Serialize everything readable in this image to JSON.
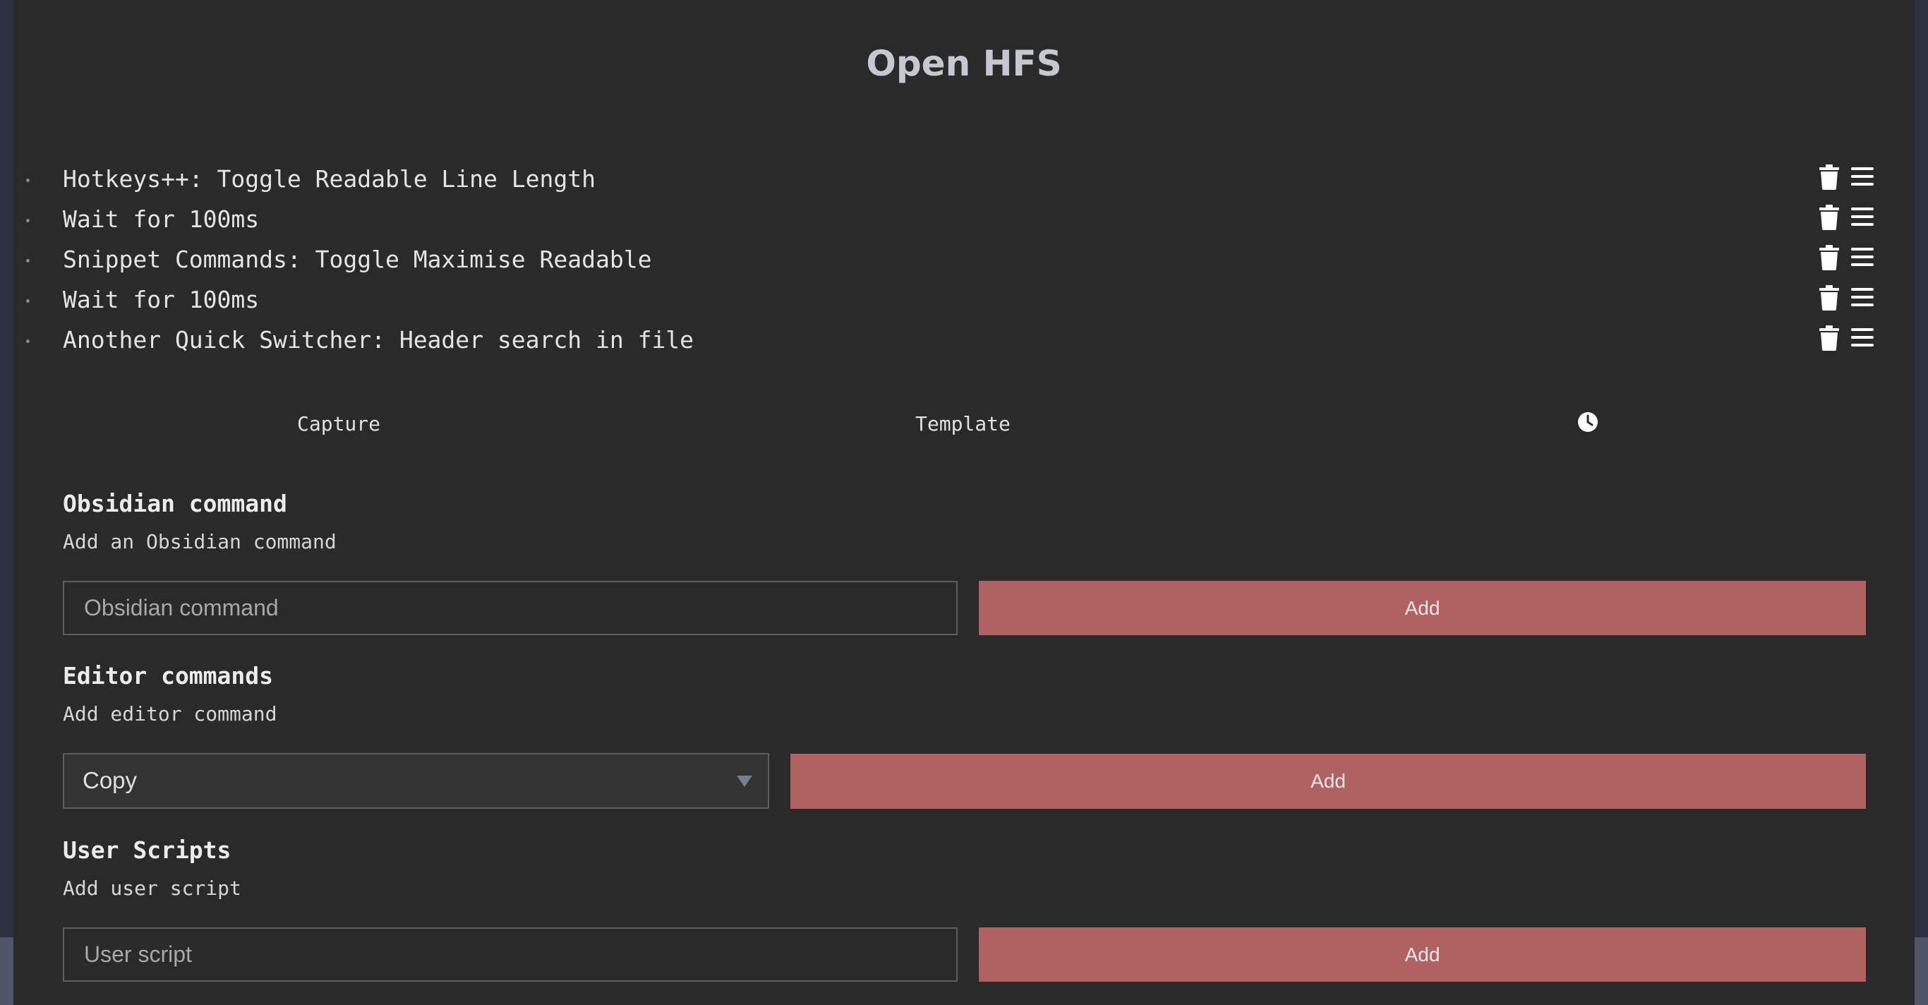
{
  "title": "Open HFS",
  "commands": [
    {
      "label": "Hotkeys++: Toggle Readable Line Length"
    },
    {
      "label": "Wait for 100ms"
    },
    {
      "label": "Snippet Commands: Toggle Maximise Readable"
    },
    {
      "label": "Wait for 100ms"
    },
    {
      "label": "Another Quick Switcher: Header search in file"
    }
  ],
  "tabs": {
    "capture": "Capture",
    "template": "Template"
  },
  "obsidian_section": {
    "heading": "Obsidian command",
    "description": "Add an Obsidian command",
    "placeholder": "Obsidian command",
    "add_label": "Add"
  },
  "editor_section": {
    "heading": "Editor commands",
    "description": "Add editor command",
    "selected": "Copy",
    "add_label": "Add"
  },
  "user_scripts_section": {
    "heading": "User Scripts",
    "description": "Add user script",
    "placeholder": "User script",
    "add_label": "Add"
  },
  "colors": {
    "background": "#2a2a2a",
    "accent": "#b06262",
    "text": "#e4e4e4"
  },
  "icons": {
    "delete": "trash-icon",
    "drag": "menu-icon",
    "wait": "clock-icon",
    "dropdown": "chevron-down-icon"
  }
}
